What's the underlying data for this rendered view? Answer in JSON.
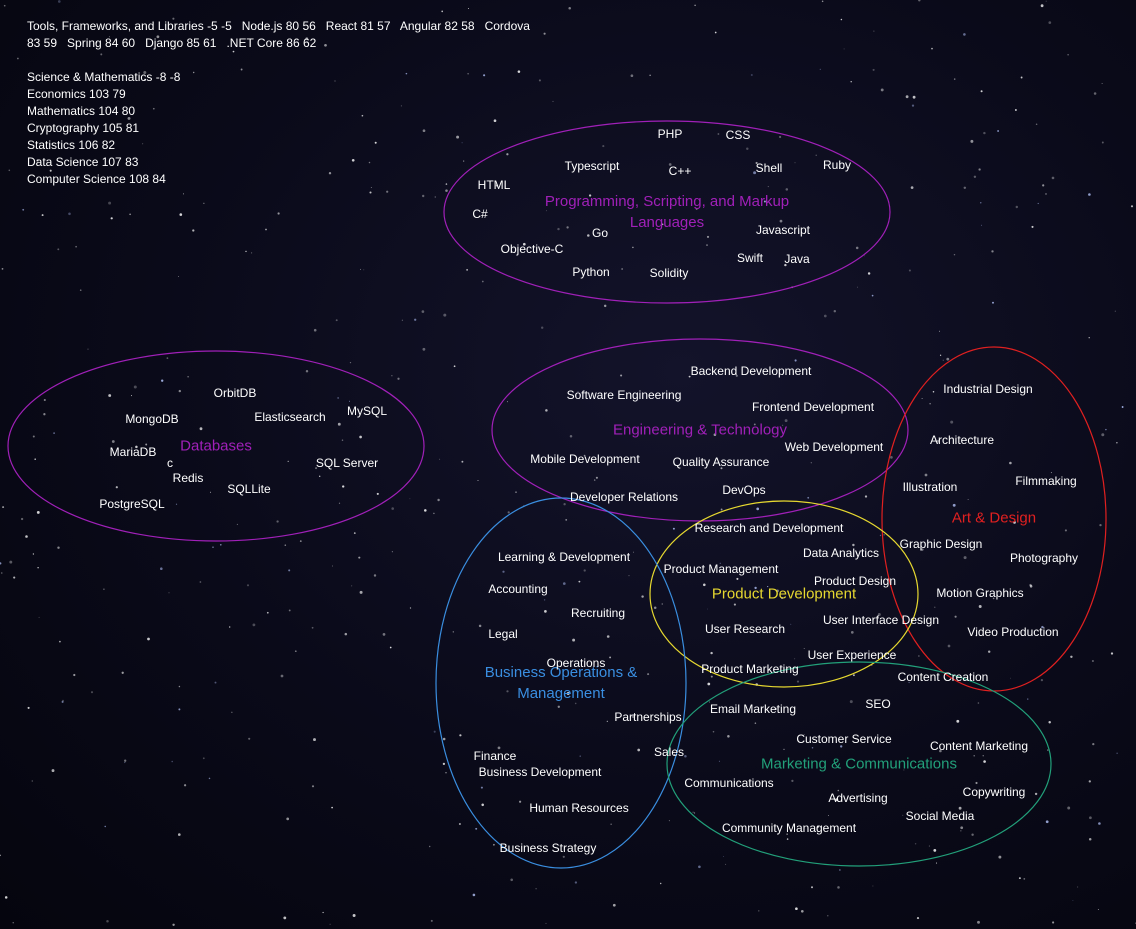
{
  "header": {
    "lines": [
      "Tools, Frameworks, and Libraries -5 -5   Node.js 80 56   React 81 57   Angular 82 58   Cordova",
      "83 59   Spring 84 60   Django 85 61   .NET Core 86 62",
      "",
      "Science & Mathematics -8 -8",
      "Economics 103 79",
      "Mathematics 104 80",
      "Cryptography 105 81",
      "Statistics 106 82",
      "Data Science 107 83",
      "Computer Science 108 84"
    ]
  },
  "clusters": [
    {
      "id": "programming",
      "label": "Programming, Scripting, and Markup\nLanguages",
      "color": "#a020b8",
      "skills": [
        "PHP",
        "CSS",
        "Typescript",
        "C++",
        "Shell",
        "Ruby",
        "HTML",
        "C#",
        "Go",
        "Javascript",
        "Objective-C",
        "Swift",
        "Java",
        "Python",
        "Solidity"
      ]
    },
    {
      "id": "databases",
      "label": "Databases",
      "color": "#a020b8",
      "skills": [
        "OrbitDB",
        "MongoDB",
        "Elasticsearch",
        "MySQL",
        "MariaDB",
        "c",
        "Redis",
        "SQL Server",
        "SQLLite",
        "PostgreSQL"
      ]
    },
    {
      "id": "engineering",
      "label": "Engineering & Technology",
      "color": "#a020b8",
      "skills": [
        "Backend Development",
        "Software Engineering",
        "Frontend Development",
        "Web Development",
        "Mobile Development",
        "Quality Assurance",
        "Developer Relations",
        "DevOps"
      ]
    },
    {
      "id": "art",
      "label": "Art & Design",
      "color": "#e02020",
      "skills": [
        "Industrial Design",
        "Architecture",
        "Illustration",
        "Filmmaking",
        "Graphic Design",
        "Photography",
        "Motion Graphics",
        "Video Production",
        "Content Creation"
      ]
    },
    {
      "id": "product",
      "label": "Product Development",
      "color": "#e6d830",
      "skills": [
        "Research and Development",
        "Data Analytics",
        "Product Management",
        "Product Design",
        "User Interface Design",
        "User Research",
        "User Experience",
        "Product Marketing"
      ]
    },
    {
      "id": "business",
      "label": "Business Operations &\nManagement",
      "color": "#3a8ee0",
      "skills": [
        "Learning & Development",
        "Accounting",
        "Recruiting",
        "Legal",
        "Operations",
        "Partnerships",
        "Sales",
        "Finance",
        "Business Development",
        "Human Resources",
        "Business Strategy"
      ]
    },
    {
      "id": "marketing",
      "label": "Marketing & Communications",
      "color": "#22a07a",
      "skills": [
        "Email Marketing",
        "SEO",
        "Customer Service",
        "Content Marketing",
        "Communications",
        "Advertising",
        "Copywriting",
        "Social Media",
        "Community Management"
      ]
    }
  ]
}
